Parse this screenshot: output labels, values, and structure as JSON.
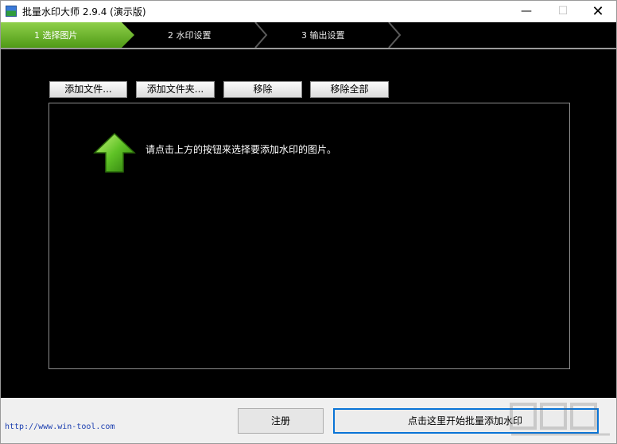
{
  "window": {
    "title": "批量水印大师 2.9.4 (演示版)",
    "controls": [
      "—",
      "☐",
      "✕"
    ]
  },
  "steps": [
    "1 选择图片",
    "2 水印设置",
    "3 输出设置"
  ],
  "toolbar": {
    "add_file": "添加文件...",
    "add_folder": "添加文件夹...",
    "remove": "移除",
    "remove_all": "移除全部"
  },
  "list": {
    "hint": "请点击上方的按钮来选择要添加水印的图片。"
  },
  "footer": {
    "url": "http://www.win-tool.com",
    "register": "注册",
    "start": "点击这里开始批量添加水印"
  },
  "colors": {
    "accent": "#0a74d6",
    "step_active": "#6db52a"
  }
}
